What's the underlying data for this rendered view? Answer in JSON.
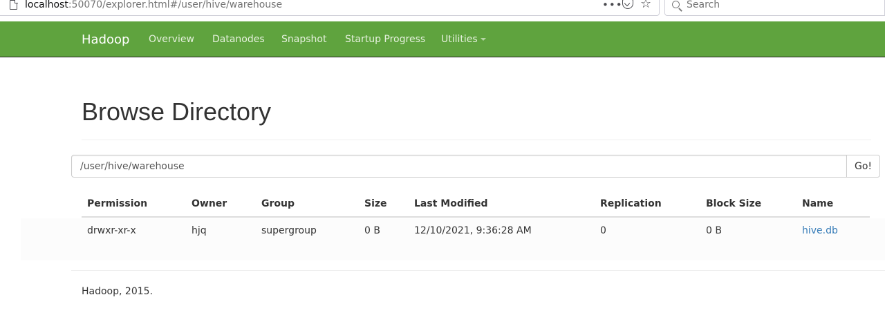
{
  "browser": {
    "url_host": "localhost",
    "url_rest": ":50070/explorer.html#/user/hive/warehouse",
    "page_actions": "•••",
    "search_placeholder": "Search"
  },
  "navbar": {
    "brand": "Hadoop",
    "items": [
      {
        "label": "Overview"
      },
      {
        "label": "Datanodes"
      },
      {
        "label": "Snapshot"
      },
      {
        "label": "Startup Progress"
      },
      {
        "label": "Utilities"
      }
    ],
    "background_color": "#5fa33e"
  },
  "main": {
    "title": "Browse Directory",
    "path_value": "/user/hive/warehouse",
    "go_label": "Go!",
    "table": {
      "headers": [
        "Permission",
        "Owner",
        "Group",
        "Size",
        "Last Modified",
        "Replication",
        "Block Size",
        "Name"
      ],
      "rows": [
        [
          "drwxr-xr-x",
          "hjq",
          "supergroup",
          "0 B",
          "12/10/2021, 9:36:28 AM",
          "0",
          "0 B",
          "hive.db"
        ]
      ]
    },
    "link_color": "#337ab7"
  },
  "footer": {
    "text": "Hadoop, 2015."
  }
}
